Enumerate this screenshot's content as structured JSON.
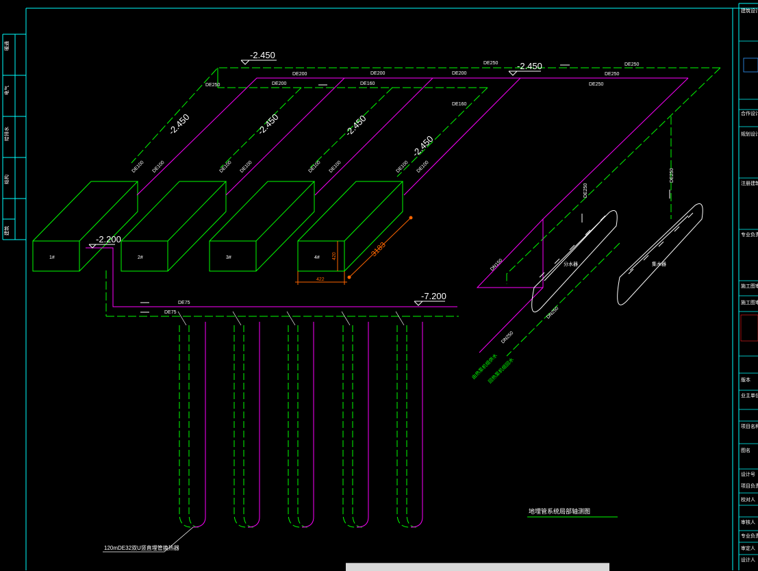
{
  "title": "地埋管系统局部轴测图",
  "elevations": {
    "main_top_left": "-2.450",
    "main_top_right": "-2.450",
    "branch_1": "-2.450",
    "branch_2": "-2.450",
    "branch_3": "-2.450",
    "branch_4": "-2.450",
    "box_return": "-2.200",
    "bottom_header": "-7.200"
  },
  "pipe_labels": {
    "de250_left": "DE250",
    "de200_a": "DE200",
    "de200_b": "DE200",
    "de200_c": "DE200",
    "de200_d": "DE200",
    "de160_a": "DE160",
    "de160_b": "DE160",
    "de160_c": "DE160",
    "de250_top": "DE250",
    "de250_right_a": "DE250",
    "de250_right_b": "DE250",
    "de250_right_c": "DE250",
    "de100_1a": "DE100",
    "de100_1b": "DE100",
    "de100_2a": "DE100",
    "de100_2b": "DE100",
    "de100_3a": "DE100",
    "de100_3b": "DE100",
    "de100_4a": "DE100",
    "de100_4b": "DE100",
    "de250_vert_a": "DE250",
    "de250_vert_b": "DE250",
    "dn150": "DN150",
    "dn250_a": "DN250",
    "dn250_b": "DN250",
    "de75_a": "DE75",
    "de75_b": "DE75",
    "dim_length": "3183",
    "dim_width": "422",
    "dim_height": "420",
    "bore_note": "120mDE32双U竖直埋管换热器"
  },
  "boxes": [
    "1#",
    "2#",
    "3#",
    "4#"
  ],
  "equipment": {
    "sep_left": "分水器",
    "sep_right": "集水器"
  },
  "side_notes": [
    "由热泵机组供水",
    "回热泵机组回水"
  ],
  "left_stamp": [
    "暖通",
    "电气",
    "给排水",
    "结构",
    "建筑"
  ],
  "title_block": [
    "建筑设计",
    "合作设计单位",
    "规划设计",
    "注册建筑师",
    "专业负责人",
    "施工图审查",
    "施工图审查",
    "版本",
    "业主单位",
    "项目名称",
    "图名",
    "设计号",
    "项目负责",
    "校对人",
    "审核人",
    "专业负责人",
    "审定人",
    "设计人"
  ],
  "toolbar": {
    "items": [
      "图层",
      "标注",
      "选择"
    ]
  },
  "colors": {
    "background": "#000000",
    "supply_pipe": "#00ff00",
    "return_pipe": "#ff00ff",
    "frame": "#00ffff",
    "dimension": "#ff6600",
    "text": "#ffffff"
  }
}
